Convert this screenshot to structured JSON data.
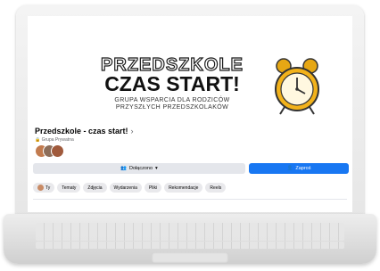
{
  "cover": {
    "title_line1": "PRZEDSZKOLE",
    "title_line2": "CZAS START!",
    "subtitle_line1": "GRUPA WSPARCIA DLA RODZICÓW",
    "subtitle_line2": "PRZYSZŁYCH PRZEDSZKOLAKÓW"
  },
  "group": {
    "name": "Przedszkole - czas start!",
    "chevron": "›",
    "type": "Grupa Prywatna"
  },
  "actions": {
    "joined_label": "Dołączono",
    "joined_icon": "people-icon",
    "dropdown_glyph": "▾",
    "invite_label": "Zaproś",
    "invite_icon": "person-plus-icon"
  },
  "tabs": [
    {
      "label": "Ty"
    },
    {
      "label": "Tematy"
    },
    {
      "label": "Zdjęcia"
    },
    {
      "label": "Wydarzenia"
    },
    {
      "label": "Pliki"
    },
    {
      "label": "Rekomendacje"
    },
    {
      "label": "Reels"
    }
  ],
  "colors": {
    "primary": "#1877f2",
    "secondary_button": "#e4e6eb",
    "clock": "#f2b21b"
  }
}
